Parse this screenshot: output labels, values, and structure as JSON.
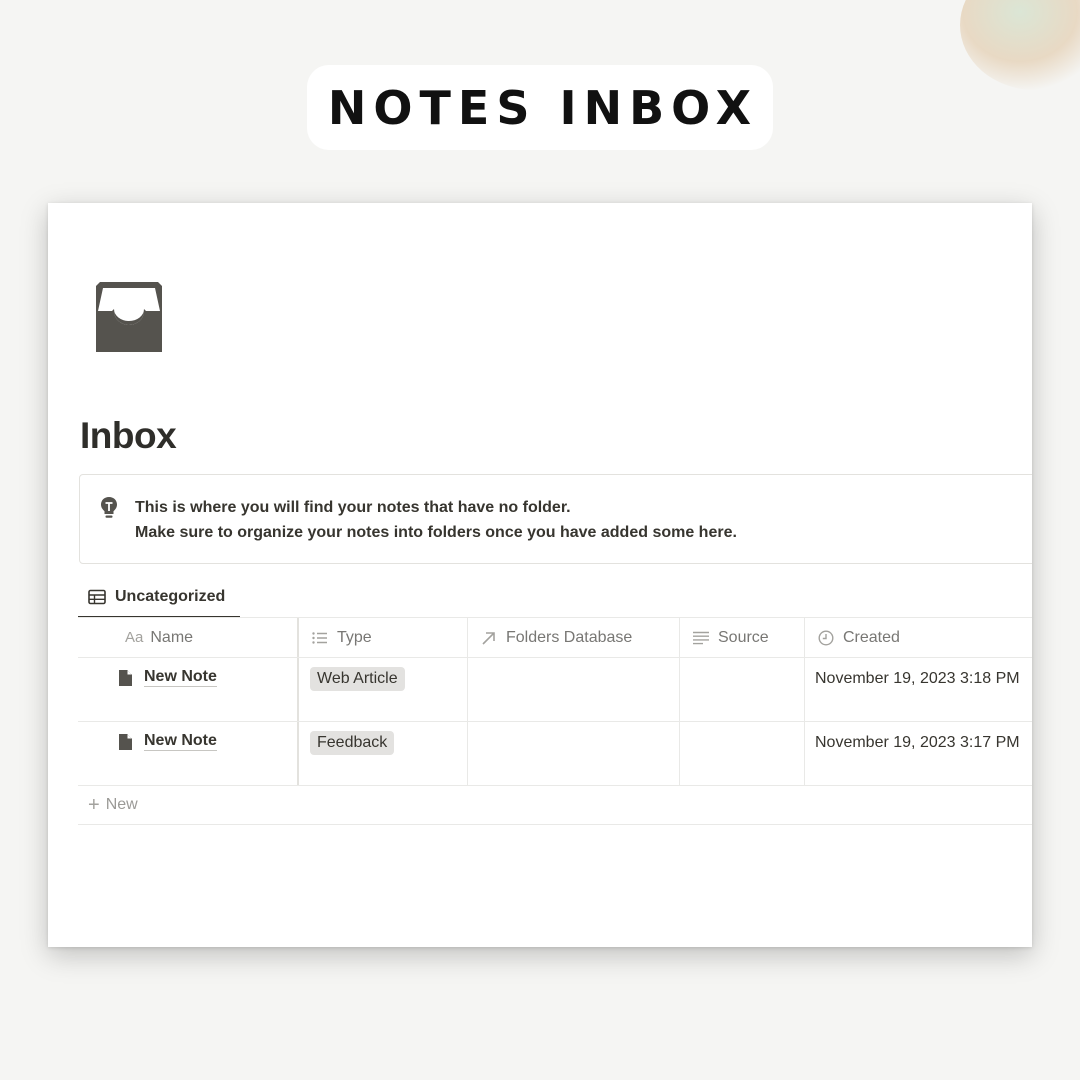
{
  "hero": {
    "title": "NOTES INBOX"
  },
  "page": {
    "icon": "inbox-tray-icon",
    "title": "Inbox",
    "callout": {
      "icon": "lightbulb-icon",
      "line1": "This is where you will find your notes that have no folder.",
      "line2": "Make sure to organize your notes into folders once you have added some here."
    }
  },
  "view_tab": {
    "icon": "table-icon",
    "label": "Uncategorized"
  },
  "table": {
    "columns": [
      {
        "icon": "title-aa-icon",
        "icon_text": "Aa",
        "label": "Name"
      },
      {
        "icon": "list-icon",
        "label": "Type"
      },
      {
        "icon": "relation-arrow-icon",
        "label": "Folders Database"
      },
      {
        "icon": "text-lines-icon",
        "label": "Source"
      },
      {
        "icon": "clock-icon",
        "label": "Created"
      }
    ],
    "rows": [
      {
        "name": "New Note",
        "type": "Web Article",
        "folders": "",
        "source": "",
        "created": "November 19, 2023 3:18 PM"
      },
      {
        "name": "New Note",
        "type": "Feedback",
        "folders": "",
        "source": "",
        "created": "November 19, 2023 3:17 PM"
      }
    ],
    "new_label": "New"
  },
  "colors": {
    "background": "#f5f5f3",
    "card": "#ffffff",
    "text": "#37352f",
    "tag_bg": "#e3e2e0",
    "icon": "#55534e"
  }
}
